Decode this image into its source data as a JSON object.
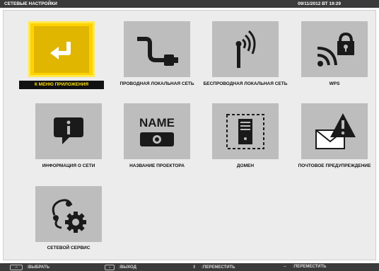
{
  "header": {
    "title": "СЕТЕВЫЕ НАСТРОЙКИ",
    "datetime": "09/11/2012 ВТ 19:29"
  },
  "items": [
    {
      "label": "К МЕНЮ ПРИЛОЖЕНИЯ",
      "icon": "back-arrow-icon",
      "selected": true
    },
    {
      "label": "ПРОВОДНАЯ ЛОКАЛЬНАЯ СЕТЬ",
      "icon": "lan-cable-icon"
    },
    {
      "label": "БЕСПРОВОДНАЯ ЛОКАЛЬНАЯ СЕТЬ",
      "icon": "wireless-antenna-icon"
    },
    {
      "label": "WPS",
      "icon": "wps-lock-icon"
    },
    {
      "label": "ИНФОРМАЦИЯ О СЕТИ",
      "icon": "info-bubble-icon"
    },
    {
      "label": "НАЗВАНИЕ ПРОЕКТОРА",
      "icon": "projector-name-icon",
      "badge_text": "NAME"
    },
    {
      "label": "ДОМЕН",
      "icon": "domain-server-icon"
    },
    {
      "label": "ПОЧТОВОЕ ПРЕДУПРЕЖДЕНИЕ",
      "icon": "mail-alert-icon"
    },
    {
      "label": "СЕТЕВОЙ СЕРВИС",
      "icon": "network-service-gear-icon"
    }
  ],
  "footer": {
    "select_label": ":ВЫБРАТЬ",
    "exit_label": ":ВЫХОД",
    "move_label_1": ":ПЕРЕМЕСТИТЬ",
    "move_label_2": ":ПЕРЕМЕСТИТЬ"
  },
  "colors": {
    "title_bar": "#3b3b3b",
    "selected": "#ffd200",
    "tile": "#bdbdbd",
    "panel": "#ececec"
  }
}
